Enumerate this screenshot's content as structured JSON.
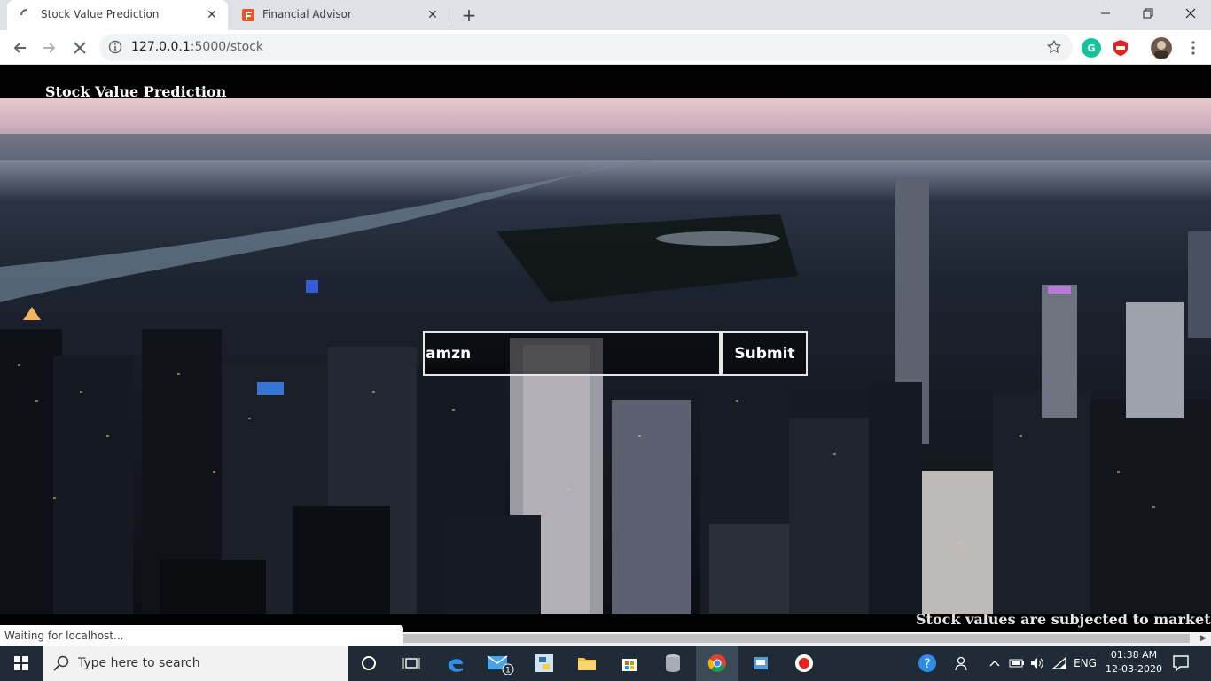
{
  "browser": {
    "tabs": [
      {
        "title": "Stock Value Prediction",
        "active": true
      },
      {
        "title": "Financial Advisor",
        "active": false
      }
    ],
    "address": {
      "host": "127.0.0.1",
      "path": ":5000/stock"
    },
    "status_text": "Waiting for localhost..."
  },
  "page": {
    "site_title": "Stock Value Prediction",
    "search": {
      "value": "amzn",
      "placeholder": ""
    },
    "submit_label": "Submit",
    "marquee": "Stock values are subjected to market risk. Pr"
  },
  "taskbar": {
    "search_placeholder": "Type here to search",
    "language": "ENG",
    "time": "01:38 AM",
    "date": "12-03-2020",
    "mail_badge": "1"
  },
  "icons": [
    "loading-spinner-icon",
    "financial-advisor-favicon",
    "close-icon",
    "new-tab-icon",
    "minimize-icon",
    "restore-icon",
    "close-window-icon",
    "back-icon",
    "forward-icon",
    "stop-icon",
    "info-icon",
    "star-icon",
    "grammarly-icon",
    "adblock-icon",
    "avatar",
    "menu-icon",
    "windows-start-icon",
    "search-icon",
    "cortana-icon",
    "task-view-icon",
    "edge-icon",
    "mail-icon",
    "python-icon",
    "file-explorer-icon",
    "store-icon",
    "database-icon",
    "chrome-icon",
    "network-app-icon",
    "record-icon",
    "help-icon",
    "people-icon",
    "chevron-up-icon",
    "battery-icon",
    "volume-icon",
    "wifi-icon",
    "notification-icon"
  ],
  "colors": {
    "tabstrip": "#dee1e6",
    "page_bg": "#000000",
    "taskbar": "#1f2c37",
    "accent_red": "#e8211d"
  }
}
